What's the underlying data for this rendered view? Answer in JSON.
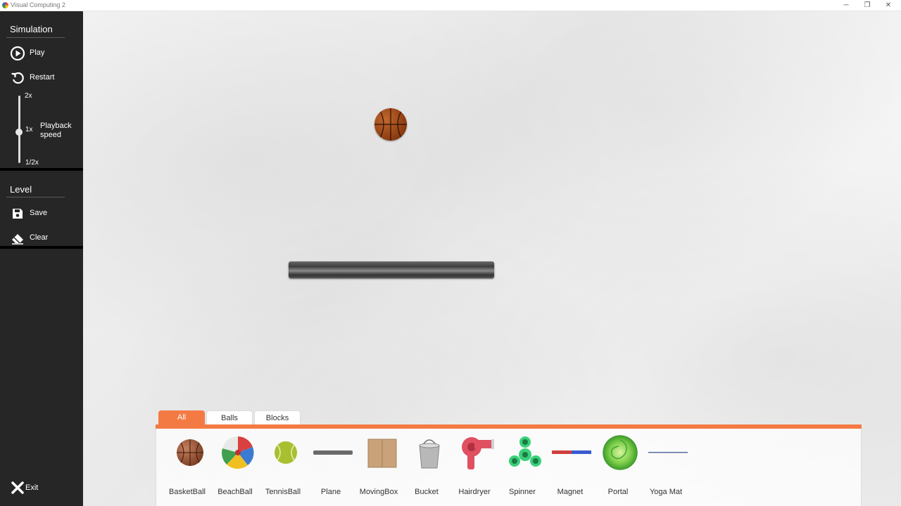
{
  "window": {
    "title": "Visual Computing 2",
    "controls": [
      "─",
      "❐",
      "✕"
    ]
  },
  "sidebar": {
    "simulation_heading": "Simulation",
    "play_label": "Play",
    "restart_label": "Restart",
    "speed": {
      "max_label": "2x",
      "mid_label": "1x",
      "min_label": "1/2x",
      "caption": "Playback speed",
      "value": "1x"
    },
    "level_heading": "Level",
    "save_label": "Save",
    "clear_label": "Clear",
    "exit_label": "Exit"
  },
  "toolbox": {
    "tabs": [
      {
        "label": "All",
        "active": true
      },
      {
        "label": "Balls",
        "active": false
      },
      {
        "label": "Blocks",
        "active": false
      }
    ],
    "items": [
      {
        "label": "BasketBall",
        "icon": "basketball-icon"
      },
      {
        "label": "BeachBall",
        "icon": "beachball-icon"
      },
      {
        "label": "TennisBall",
        "icon": "tennisball-icon"
      },
      {
        "label": "Plane",
        "icon": "plane-icon"
      },
      {
        "label": "MovingBox",
        "icon": "box-icon"
      },
      {
        "label": "Bucket",
        "icon": "bucket-icon"
      },
      {
        "label": "Hairdryer",
        "icon": "hairdryer-icon"
      },
      {
        "label": "Spinner",
        "icon": "spinner-icon"
      },
      {
        "label": "Magnet",
        "icon": "magnet-icon"
      },
      {
        "label": "Portal",
        "icon": "portal-icon"
      },
      {
        "label": "Yoga Mat",
        "icon": "yogamat-icon"
      }
    ]
  },
  "colors": {
    "accent": "#f47a44",
    "sidebar_bg": "#262626"
  }
}
